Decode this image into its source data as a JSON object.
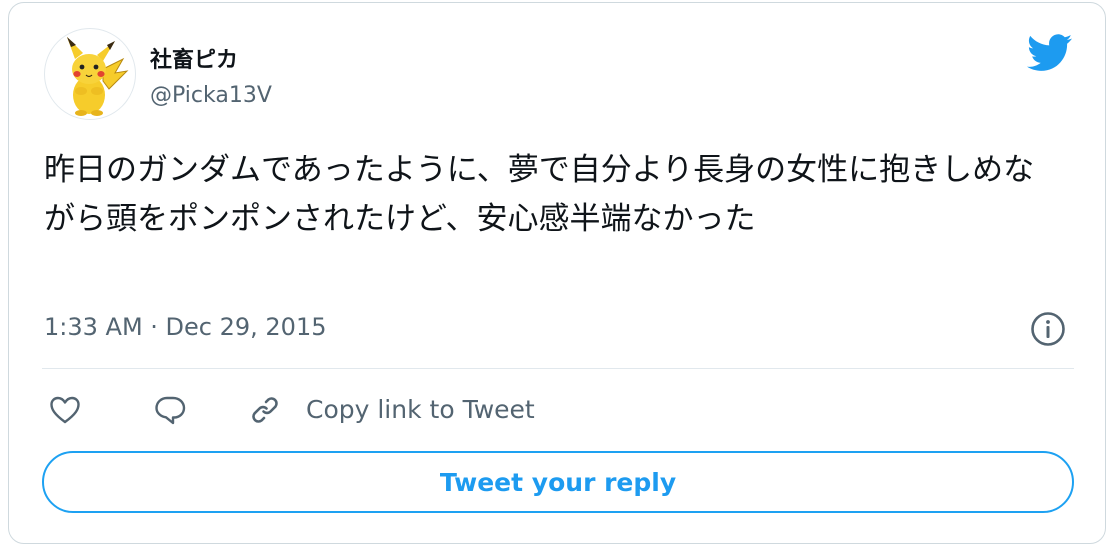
{
  "author": {
    "display_name": "社畜ピカ",
    "handle": "@Picka13V"
  },
  "tweet": {
    "text": "昨日のガンダムであったように、夢で自分より長身の女性に抱きしめながら頭をポンポンされたけど、安心感半端なかった",
    "timestamp": "1:33 AM · Dec 29, 2015"
  },
  "actions": {
    "copy_link_label": "Copy link to Tweet",
    "reply_button_label": "Tweet your reply"
  },
  "icons": {
    "brand": "twitter-bird-icon",
    "info": "info-icon",
    "like": "heart-icon",
    "reply": "speech-bubble-icon",
    "link": "chain-link-icon"
  },
  "colors": {
    "accent": "#1d9bf0",
    "text_primary": "#0f1419",
    "text_secondary": "#536471",
    "border": "#cfd9de"
  }
}
